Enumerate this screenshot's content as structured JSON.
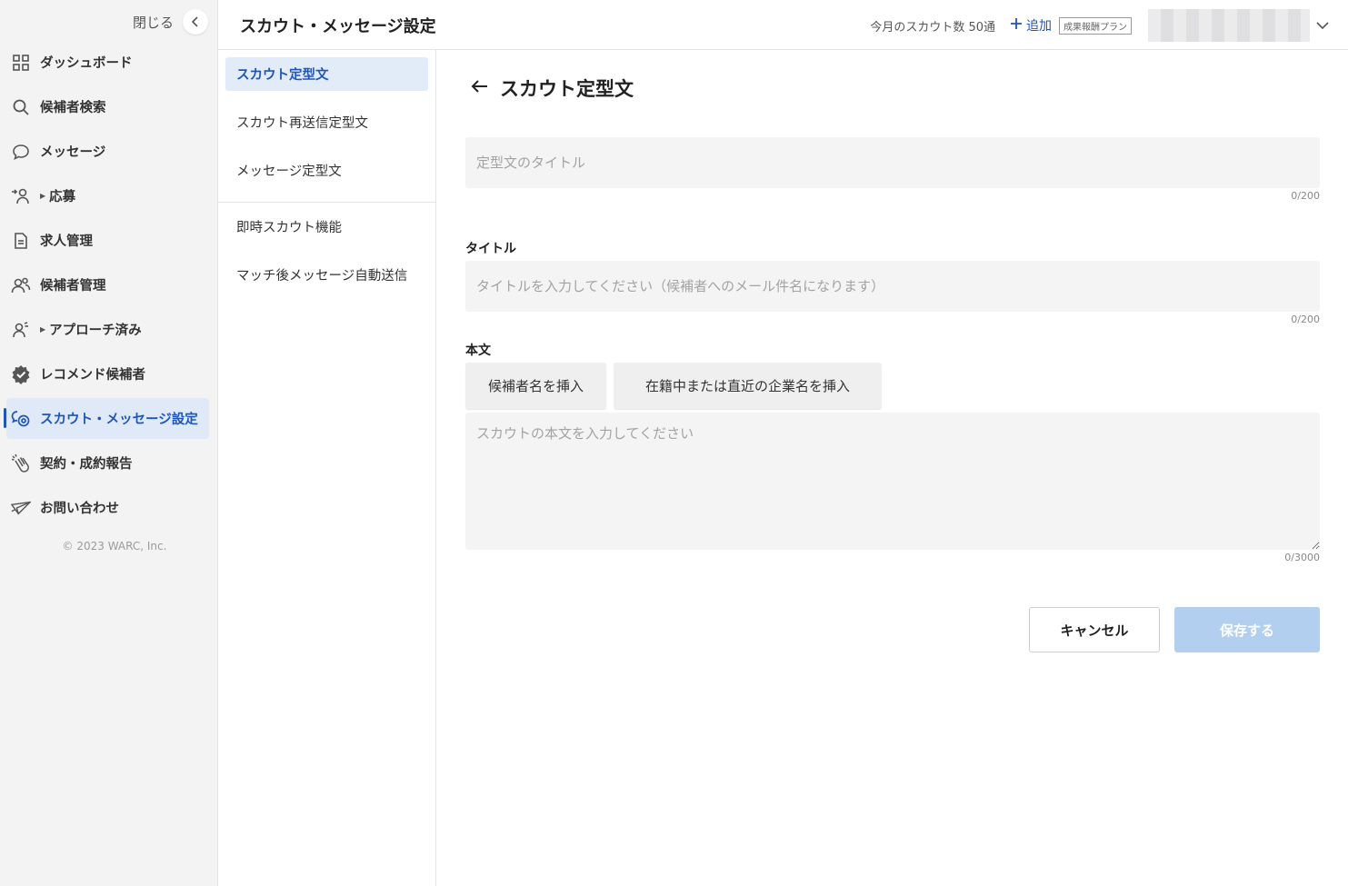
{
  "sidebar": {
    "close_label": "閉じる",
    "items": [
      {
        "label": "ダッシュボード",
        "icon": "grid-icon"
      },
      {
        "label": "候補者検索",
        "icon": "search-icon"
      },
      {
        "label": "メッセージ",
        "icon": "chat-bubble-icon"
      },
      {
        "label": "応募",
        "icon": "person-arrow-icon"
      },
      {
        "label": "求人管理",
        "icon": "document-icon"
      },
      {
        "label": "候補者管理",
        "icon": "people-icon"
      },
      {
        "label": "アプローチ済み",
        "icon": "person-signal-icon"
      },
      {
        "label": "レコメンド候補者",
        "icon": "verified-badge-icon"
      },
      {
        "label": "スカウト・メッセージ設定",
        "icon": "chat-gear-icon"
      },
      {
        "label": "契約・成約報告",
        "icon": "clap-icon"
      },
      {
        "label": "お問い合わせ",
        "icon": "paper-plane-icon"
      }
    ],
    "copyright": "© 2023 WARC, Inc."
  },
  "header": {
    "title": "スカウト・メッセージ設定",
    "scout_count": "今月のスカウト数 50通",
    "add_label": "追加",
    "plan_badge": "成果報酬プラン"
  },
  "subnav": {
    "items": [
      "スカウト定型文",
      "スカウト再送信定型文",
      "メッセージ定型文",
      "即時スカウト機能",
      "マッチ後メッセージ自動送信"
    ]
  },
  "form": {
    "page_heading": "スカウト定型文",
    "template_title_placeholder": "定型文のタイトル",
    "template_title_counter": "0/200",
    "title_label": "タイトル",
    "title_placeholder": "タイトルを入力してください（候補者へのメール件名になります）",
    "title_counter": "0/200",
    "body_label": "本文",
    "insert_candidate_name": "候補者名を挿入",
    "insert_company_name": "在籍中または直近の企業名を挿入",
    "body_placeholder": "スカウトの本文を入力してください",
    "body_counter": "0/3000",
    "cancel_label": "キャンセル",
    "save_label": "保存する"
  },
  "colors": {
    "accent": "#1f56b8",
    "active_bg": "#dfe9f7",
    "save_disabled": "#b3cff0"
  }
}
